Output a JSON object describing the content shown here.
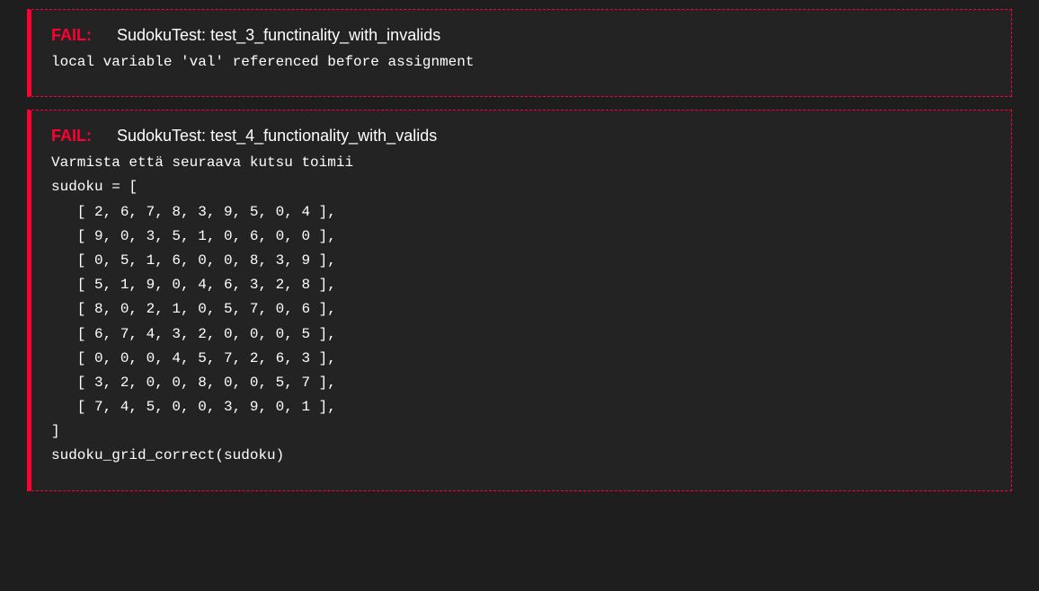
{
  "tests": [
    {
      "status_label": "FAIL:",
      "test_name": "SudokuTest: test_3_functinality_with_invalids",
      "message": "local variable 'val' referenced before assignment"
    },
    {
      "status_label": "FAIL:",
      "test_name": "SudokuTest: test_4_functionality_with_valids",
      "message": "Varmista että seuraava kutsu toimii\nsudoku = [\n   [ 2, 6, 7, 8, 3, 9, 5, 0, 4 ],\n   [ 9, 0, 3, 5, 1, 0, 6, 0, 0 ],\n   [ 0, 5, 1, 6, 0, 0, 8, 3, 9 ],\n   [ 5, 1, 9, 0, 4, 6, 3, 2, 8 ],\n   [ 8, 0, 2, 1, 0, 5, 7, 0, 6 ],\n   [ 6, 7, 4, 3, 2, 0, 0, 0, 5 ],\n   [ 0, 0, 0, 4, 5, 7, 2, 6, 3 ],\n   [ 3, 2, 0, 0, 8, 0, 0, 5, 7 ],\n   [ 7, 4, 5, 0, 0, 3, 9, 0, 1 ],\n]\nsudoku_grid_correct(sudoku)"
    }
  ]
}
